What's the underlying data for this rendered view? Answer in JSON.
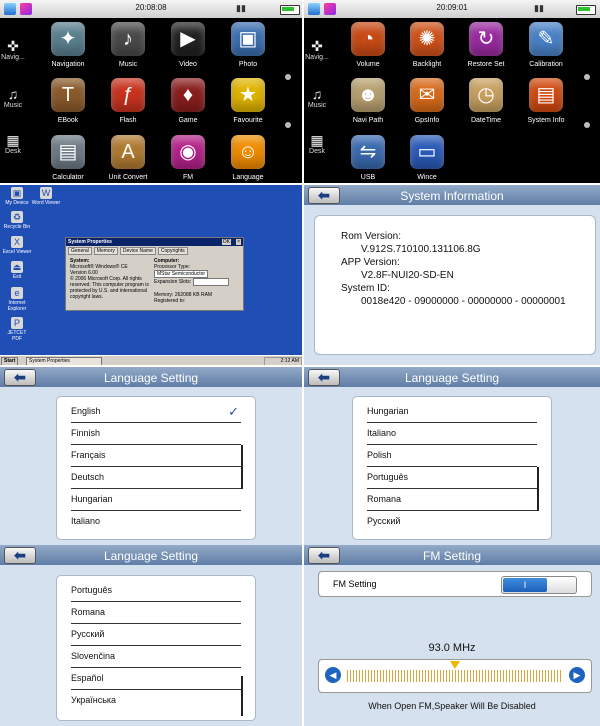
{
  "menu1": {
    "time": "20:08:08",
    "sidebar": [
      {
        "label": "Navig...",
        "glyph": "✜"
      },
      {
        "label": "Music",
        "glyph": "♫"
      },
      {
        "label": "Desk",
        "glyph": "▦"
      }
    ],
    "apps": [
      {
        "label": "Navigation",
        "glyph": "✦",
        "color": "#5a7f8f"
      },
      {
        "label": "Music",
        "glyph": "♪",
        "color": "#4a4a4a"
      },
      {
        "label": "Video",
        "glyph": "▶",
        "color": "#222222"
      },
      {
        "label": "Photo",
        "glyph": "▣",
        "color": "#3b6fb0"
      },
      {
        "label": "EBook",
        "glyph": "T",
        "color": "#8a5a2a"
      },
      {
        "label": "Flash",
        "glyph": "ƒ",
        "color": "#c8321e"
      },
      {
        "label": "Game",
        "glyph": "♦",
        "color": "#8a1e1e"
      },
      {
        "label": "Favourite",
        "glyph": "★",
        "color": "#e0b400"
      },
      {
        "label": "Calculator",
        "glyph": "▤",
        "color": "#6e7a86"
      },
      {
        "label": "Unit Convert",
        "glyph": "A",
        "color": "#b07a30"
      },
      {
        "label": "FM",
        "glyph": "◉",
        "color": "#b4228a"
      },
      {
        "label": "Language",
        "glyph": "☺",
        "color": "#f08c00"
      }
    ]
  },
  "menu2": {
    "time": "20:09:01",
    "sidebar": [
      {
        "label": "Navig...",
        "glyph": "✜"
      },
      {
        "label": "Music",
        "glyph": "♫"
      },
      {
        "label": "Desk",
        "glyph": "▦"
      }
    ],
    "apps": [
      {
        "label": "Volume",
        "glyph": "◔",
        "color": "#c84a14"
      },
      {
        "label": "Backlight",
        "glyph": "✺",
        "color": "#d0521a"
      },
      {
        "label": "Restore Set",
        "glyph": "↻",
        "color": "#9a2aa0"
      },
      {
        "label": "Calibration",
        "glyph": "✎",
        "color": "#4a82c8"
      },
      {
        "label": "Navi Path",
        "glyph": "☻",
        "color": "#b8a070"
      },
      {
        "label": "GpsInfo",
        "glyph": "✉",
        "color": "#d86a1a"
      },
      {
        "label": "DateTime",
        "glyph": "◷",
        "color": "#c8a060"
      },
      {
        "label": "System Info",
        "glyph": "▤",
        "color": "#d04a10"
      },
      {
        "label": "USB",
        "glyph": "⇋",
        "color": "#3a6ab0"
      },
      {
        "label": "Wince",
        "glyph": "▭",
        "color": "#2a5ab8"
      }
    ]
  },
  "desktop": {
    "icons": [
      "My Device",
      "Word Viewer",
      "Recycle Bin",
      "Excel Viewer",
      "Exit",
      "Internet Explorer",
      "JETCET PDF"
    ],
    "dialog": {
      "title": "System Properties",
      "ok": "OK",
      "close": "×",
      "tabs": [
        "General",
        "Memory",
        "Device Name",
        "Copyrights"
      ],
      "system_label": "System:",
      "system_lines": [
        "Microsoft® Windows® CE",
        "Version 6.00",
        "© 2006 Microsoft Corp. All rights reserved. This computer program is protected by U.S. and international copyright laws."
      ],
      "computer_label": "Computer:",
      "processor_label": "Processor Type:",
      "processor_value": "MStar Semiconductor",
      "expansion_label": "Expansion Slots:",
      "memory_label": "Memory:",
      "memory_value": "262088 KB  RAM",
      "registered_label": "Registered to:"
    },
    "taskbar": {
      "start": "Start",
      "task": "System Properties",
      "time": "2:12 AM"
    }
  },
  "sysinfo": {
    "title": "System Information",
    "rom_label": "Rom Version:",
    "rom_value": "V.912S.710100.131106.8G",
    "app_label": "APP Version:",
    "app_value": "V2.8F-NUI20-SD-EN",
    "id_label": "System ID:",
    "id_value": "0018e420 - 09000000 - 00000000 - 00000001"
  },
  "lang1": {
    "title": "Language Setting",
    "items": [
      "English",
      "Finnish",
      "Français",
      "Deutsch",
      "Hungarian",
      "Italiano"
    ],
    "selected": "✓"
  },
  "lang2": {
    "title": "Language Setting",
    "items": [
      "Hungarian",
      "Italiano",
      "Polish",
      "Português",
      "Romana",
      "Русский"
    ]
  },
  "lang3": {
    "title": "Language Setting",
    "items": [
      "Português",
      "Romana",
      "Русский",
      "Slovenčina",
      "Español",
      "Українська"
    ]
  },
  "fm": {
    "title": "FM Setting",
    "row_label": "FM Setting",
    "toggle_state": "I",
    "frequency": "93.0 MHz",
    "tuner_level": 0.5,
    "note": "When Open FM,Speaker Will Be Disabled",
    "left_arrow": "◀",
    "right_arrow": "▶"
  },
  "back_arrow": "⬅"
}
